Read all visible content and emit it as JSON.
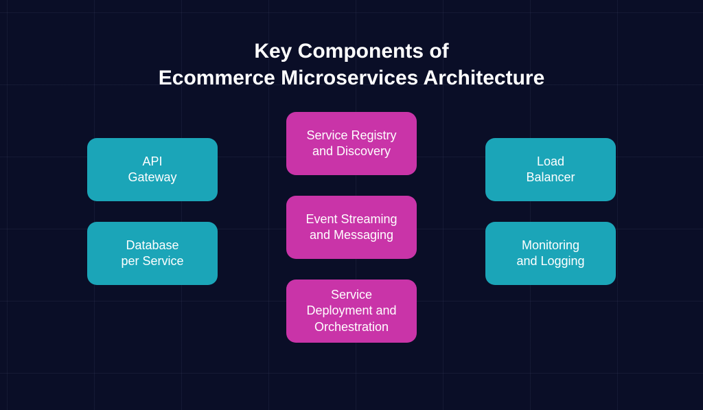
{
  "title": {
    "line1": "Key Components of",
    "line2": "Ecommerce Microservices Architecture"
  },
  "columns": {
    "left": [
      {
        "label_line1": "API",
        "label_line2": "Gateway"
      },
      {
        "label_line1": "Database",
        "label_line2": "per Service"
      }
    ],
    "middle": [
      {
        "label_line1": "Service Registry",
        "label_line2": "and Discovery"
      },
      {
        "label_line1": "Event Streaming",
        "label_line2": "and Messaging"
      },
      {
        "label_line1": "Service",
        "label_line2": "Deployment and",
        "label_line3": "Orchestration"
      }
    ],
    "right": [
      {
        "label_line1": "Load",
        "label_line2": "Balancer"
      },
      {
        "label_line1": "Monitoring",
        "label_line2": "and Logging"
      }
    ]
  }
}
